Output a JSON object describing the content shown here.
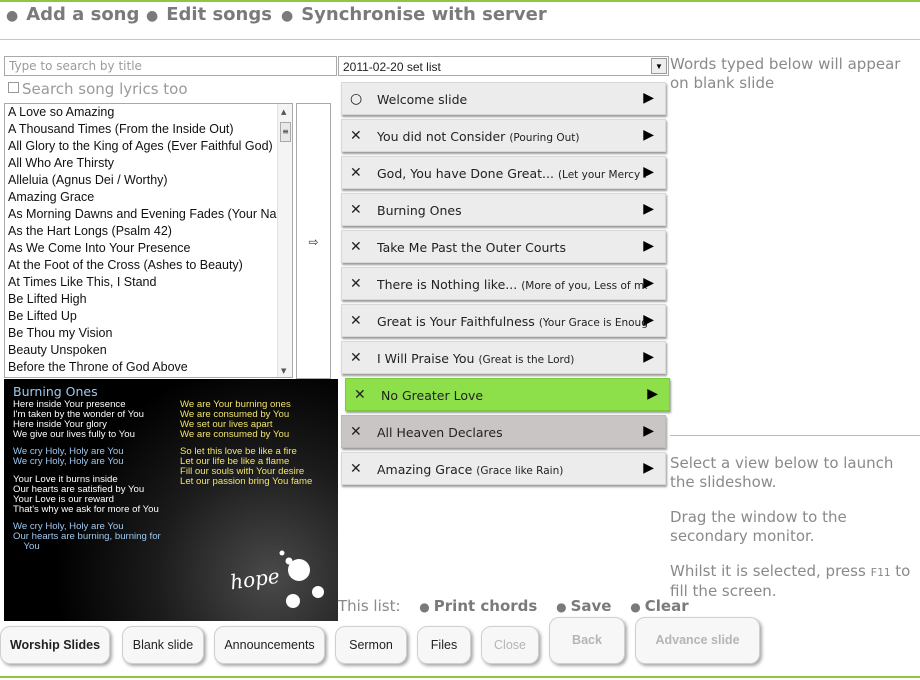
{
  "nav": {
    "add_song": "Add a song",
    "edit_songs": "Edit songs",
    "synchronise": "Synchronise with server"
  },
  "search": {
    "placeholder": "Type to search by title",
    "lyrics_label": "Search song lyrics too"
  },
  "setlist_select": {
    "value": "2011-02-20 set list"
  },
  "add_arrow": "⇨",
  "songs": [
    "A Love so Amazing",
    "A Thousand Times (From the Inside Out)",
    "All Glory to the King of Ages (Ever Faithful God)",
    "All Who Are Thirsty",
    "Alleluia (Agnus Dei / Worthy)",
    "Amazing Grace",
    "As Morning Dawns and Evening Fades (Your Name)",
    "As the Hart Longs (Psalm 42)",
    "As We Come Into Your Presence",
    "At the Foot of the Cross (Ashes to Beauty)",
    "At Times Like This, I Stand",
    "Be Lifted High",
    "Be Lifted Up",
    "Be Thou my Vision",
    "Beauty Unspoken",
    "Before the Throne of God Above"
  ],
  "preview": {
    "title": "Burning Ones",
    "left_white_1": "Here inside Your presence\nI'm taken by the wonder of You\nHere inside Your glory\nWe give our lives fully to You",
    "left_blue_1": "We cry Holy, Holy are You\nWe cry Holy, Holy are You",
    "left_white_2": "Your Love it burns inside\nOur hearts are satisfied by You\nYour Love is our reward\nThat's why we ask for more of You",
    "left_blue_2": "We cry Holy, Holy are You\nOur hearts are burning, burning for\n    You",
    "right_yellow_1": "We are Your burning ones\nWe are consumed by You\nWe set our lives apart\nWe are consumed by You",
    "right_yellow_2": "So let this love be like a fire\nLet our life be like a flame\nFill our souls with Your desire\nLet our passion bring You fame",
    "logo_text": "hope"
  },
  "setlist": [
    {
      "mark": "○",
      "title": "Welcome slide",
      "sub": ""
    },
    {
      "mark": "✕",
      "title": "You did not Consider ",
      "sub": "(Pouring Out)"
    },
    {
      "mark": "✕",
      "title": "God, You have Done Great... ",
      "sub": "(Let your Mercy Rain)"
    },
    {
      "mark": "✕",
      "title": "Burning Ones",
      "sub": ""
    },
    {
      "mark": "✕",
      "title": "Take Me Past the Outer Courts",
      "sub": ""
    },
    {
      "mark": "✕",
      "title": "There is Nothing like... ",
      "sub": "(More of you, Less of me)"
    },
    {
      "mark": "✕",
      "title": "Great is Your Faithfulness ",
      "sub": "(Your Grace is Enough)"
    },
    {
      "mark": "✕",
      "title": "I Will Praise You ",
      "sub": "(Great is the Lord)"
    },
    {
      "mark": "✕",
      "title": "No Greater Love",
      "sub": ""
    },
    {
      "mark": "✕",
      "title": "All Heaven Declares",
      "sub": ""
    },
    {
      "mark": "✕",
      "title": "Amazing Grace ",
      "sub": "(Grace like Rain)"
    }
  ],
  "play_glyph": "▶",
  "colors": {
    "accent_green": "#8ee04a",
    "selected_gray": "#c9c5c5",
    "nav_line": "#8ec640"
  },
  "words": {
    "label": "Words typed below will appear on blank slide"
  },
  "launch": {
    "p1": "Select a view below to launch the slideshow.",
    "p2": "Drag the window to the secondary monitor.",
    "p3_a": "Whilst it is selected, press ",
    "p3_key": "F11",
    "p3_b": " to fill the screen."
  },
  "thislist": {
    "label": "This list:",
    "print": "Print chords",
    "save": "Save",
    "clear": "Clear"
  },
  "buttons": {
    "worship": "Worship Slides",
    "blank": "Blank slide",
    "announcements": "Announcements",
    "sermon": "Sermon",
    "files": "Files",
    "close": "Close",
    "back": "Back",
    "advance": "Advance slide"
  }
}
